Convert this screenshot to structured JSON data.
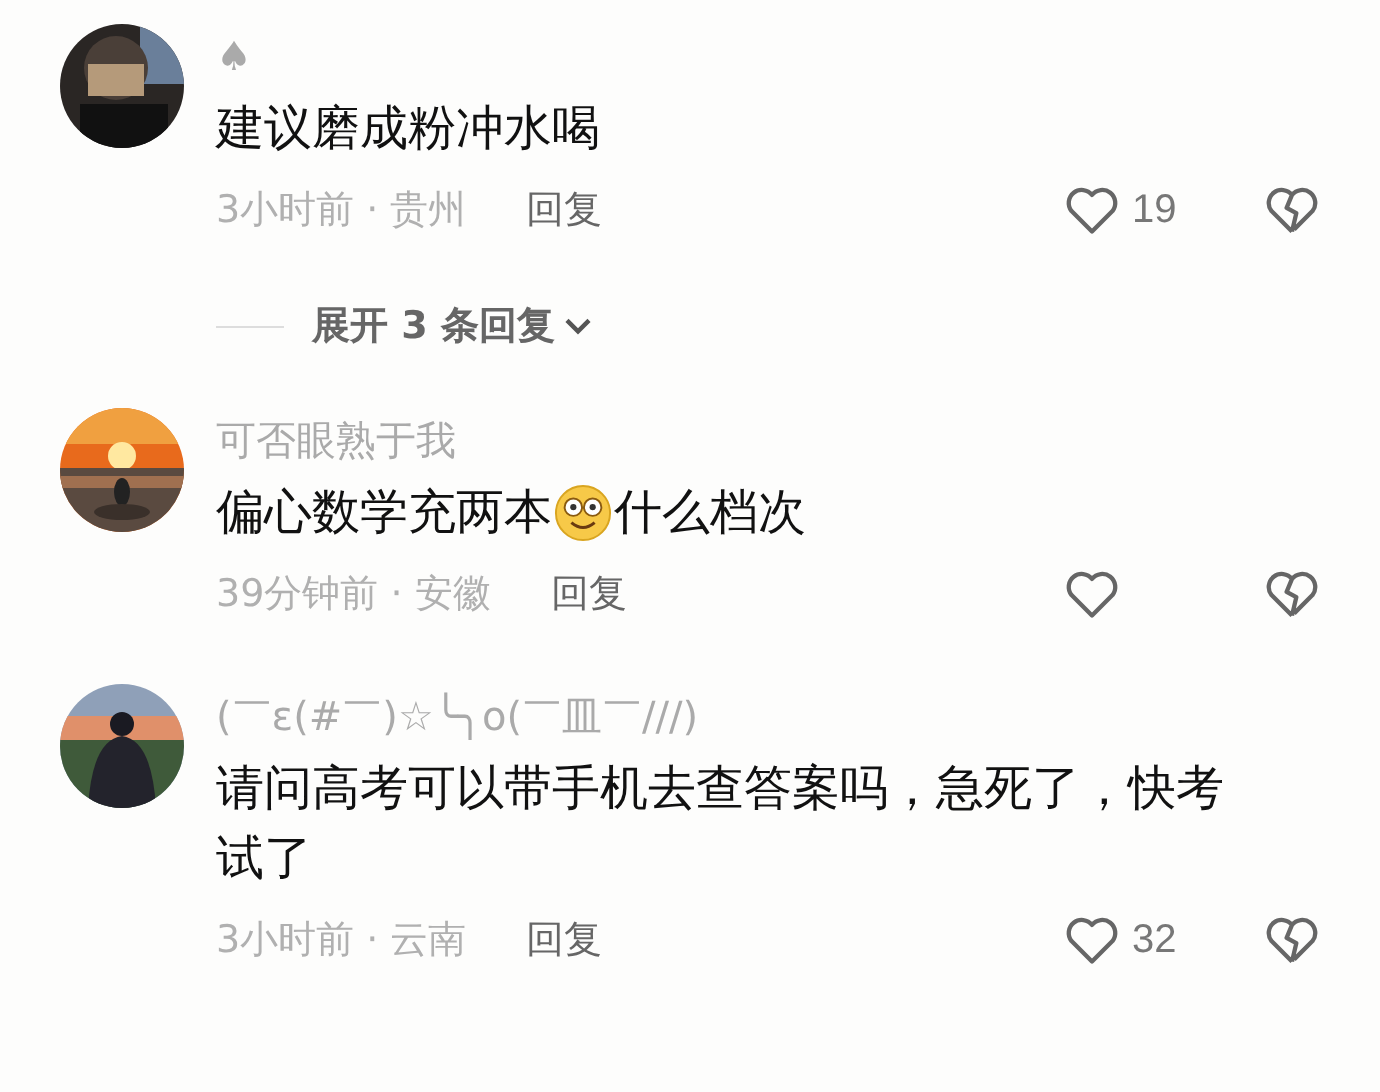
{
  "comments": [
    {
      "name": "♠",
      "content": [
        {
          "kind": "text",
          "text": "建议磨成粉冲水喝"
        }
      ],
      "time": "3小时前 · 贵州",
      "reply": "回复",
      "likes": "19",
      "expand": "展开 3 条回复"
    },
    {
      "name": "可否眼熟于我",
      "content": [
        {
          "kind": "text",
          "text": "偏心数学充两本"
        },
        {
          "kind": "emoji"
        },
        {
          "kind": "text",
          "text": "什么档次"
        }
      ],
      "time": "39分钟前 · 安徽",
      "reply": "回复"
    },
    {
      "name": "(￣ε(#￣)☆╰╮o(￣皿￣///)",
      "content": [
        {
          "kind": "text",
          "text": "请问高考可以带手机去查答案吗，急死了，快考试了"
        }
      ],
      "time": "3小时前 · 云南",
      "reply": "回复",
      "likes": "32"
    }
  ]
}
